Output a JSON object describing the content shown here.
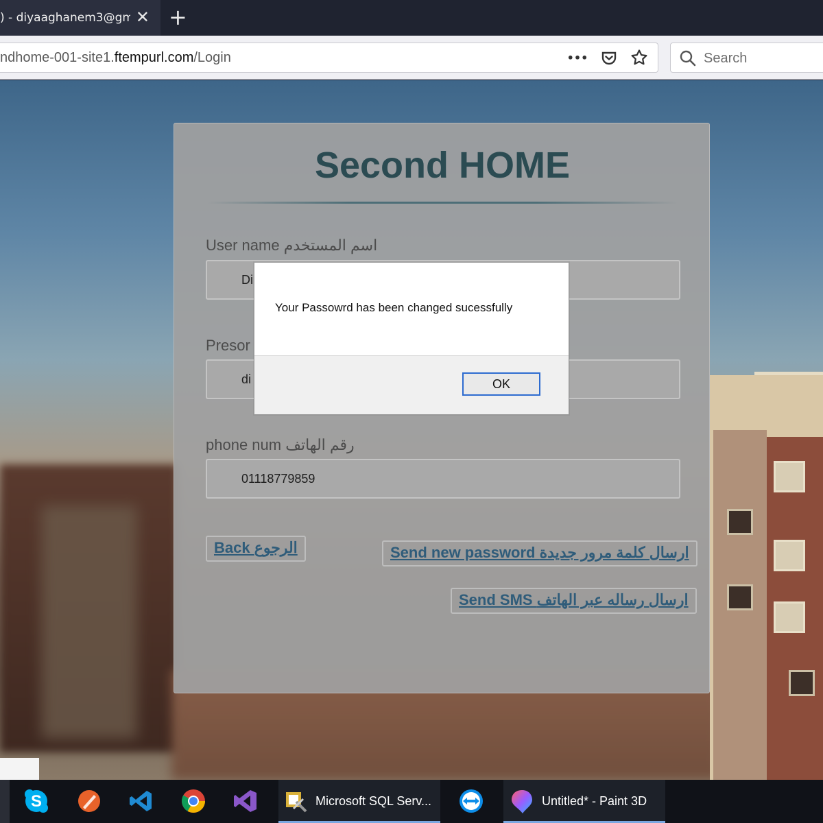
{
  "browser": {
    "tab_title": ") - diyaaghanem3@gm",
    "tab_close": "✕",
    "new_tab": "+",
    "url_path_prefix": "ndhome-001-site1.",
    "url_host": "ftempurl.com",
    "url_path": "/Login",
    "page_actions_more": "•••",
    "search_placeholder": "Search"
  },
  "login": {
    "title": "Second HOME",
    "username_label": "User name اسم المستخدم",
    "username_value": "Di",
    "password_label": "Presor",
    "password_value": "di",
    "phone_label": "phone num رقم الهاتف",
    "phone_value": "01118779859",
    "back_link": "Back الرجوع",
    "send_password_link": "Send new password ارسال كلمة مرور جديدة",
    "send_sms_link": "Send SMS ارسال رساله عبر الهاتف"
  },
  "alert": {
    "message": "Your Passowrd has been changed sucessfully",
    "ok_label": "OK"
  },
  "taskbar": {
    "apps": [
      {
        "icon": "skype-icon"
      },
      {
        "icon": "pen-tool-icon"
      },
      {
        "icon": "vscode-icon"
      },
      {
        "icon": "chrome-icon"
      },
      {
        "icon": "visual-studio-icon"
      },
      {
        "icon": "sql-server-icon",
        "label": "Microsoft SQL Serv..."
      },
      {
        "icon": "teamviewer-icon"
      },
      {
        "icon": "paint3d-icon",
        "label": "Untitled* - Paint 3D"
      }
    ]
  },
  "colors": {
    "title_color": "#2b4b52",
    "link_color": "#2f5c7a",
    "ok_border": "#2d6bd0",
    "taskbar_bg": "#101218"
  }
}
